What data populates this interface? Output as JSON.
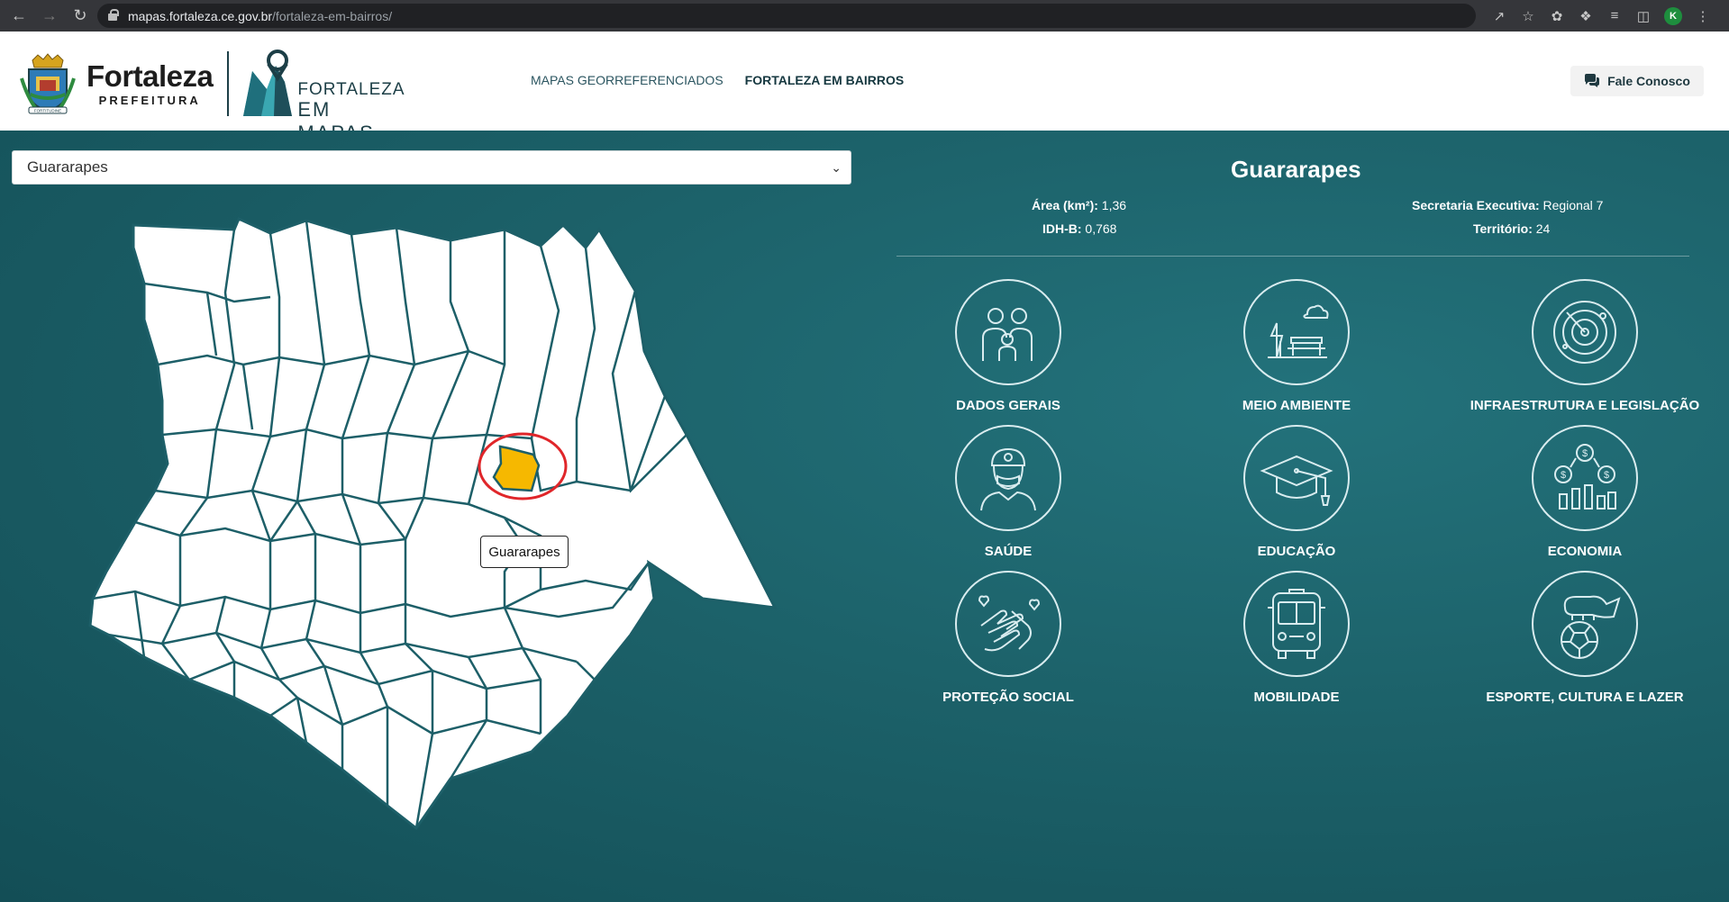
{
  "browser": {
    "url_host": "mapas.fortaleza.ce.gov.br",
    "url_path": "/fortaleza-em-bairros/",
    "profile_initial": "K"
  },
  "header": {
    "brand_name": "Fortaleza",
    "brand_sub": "PREFEITURA",
    "crest_motto": "FORTITUDINE",
    "emapas_line1": "FORTALEZA",
    "emapas_line2": "EM MAPAS",
    "nav": [
      {
        "label": "MAPAS GEORREFERENCIADOS"
      },
      {
        "label": "FORTALEZA EM BAIRROS"
      }
    ],
    "contact_label": "Fale Conosco"
  },
  "selector": {
    "value": "Guararapes"
  },
  "map": {
    "tooltip": "Guararapes",
    "highlight_color": "#f6b800",
    "marker_color": "#e0262a"
  },
  "info": {
    "title": "Guararapes",
    "area_label": "Área (km²):",
    "area_value": " 1,36",
    "idh_label": "IDH-B:",
    "idh_value": " 0,768",
    "secretaria_label": "Secretaria Executiva:",
    "secretaria_value": " Regional 7",
    "territorio_label": "Território:",
    "territorio_value": " 24"
  },
  "cards": [
    {
      "label": "DADOS GERAIS",
      "icon": "family-icon"
    },
    {
      "label": "MEIO AMBIENTE",
      "icon": "park-icon"
    },
    {
      "label": "INFRAESTRUTURA E LEGISLAÇÃO",
      "icon": "radar-icon"
    },
    {
      "label": "SAÚDE",
      "icon": "doctor-icon"
    },
    {
      "label": "EDUCAÇÃO",
      "icon": "graduation-cap-icon"
    },
    {
      "label": "ECONOMIA",
      "icon": "money-chart-icon"
    },
    {
      "label": "PROTEÇÃO SOCIAL",
      "icon": "caring-hands-icon"
    },
    {
      "label": "MOBILIDADE",
      "icon": "bus-icon"
    },
    {
      "label": "ESPORTE, CULTURA E LAZER",
      "icon": "football-icon"
    }
  ],
  "colors": {
    "teal_background": "#1a5d66",
    "header_background": "#ffffff"
  }
}
